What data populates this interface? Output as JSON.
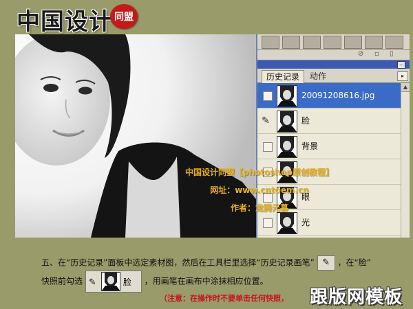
{
  "header": {
    "logo_text": "中国设计",
    "logo_seal": "同盟"
  },
  "history_panel": {
    "tabs": [
      {
        "label": "历史记录",
        "active": true
      },
      {
        "label": "动作",
        "active": false
      }
    ],
    "rows": [
      {
        "label": "20091208616.jpg",
        "selected": true,
        "source_brush": false
      },
      {
        "label": "脸",
        "selected": false,
        "source_brush": true
      },
      {
        "label": "背景",
        "selected": false,
        "source_brush": false
      },
      {
        "label": "",
        "selected": false,
        "source_brush": false
      },
      {
        "label": "眼",
        "selected": false,
        "source_brush": false
      },
      {
        "label": "光",
        "selected": false,
        "source_brush": false
      }
    ]
  },
  "watermark": {
    "line1": "中国设计同盟【photoshop原创教程】",
    "line2": "网址：www.cntoem.cn",
    "line3": "作者：龙腾元慕"
  },
  "instructions": {
    "line1_part1": "五、在“历史记录”面板中选定素材图，然后在工具栏里选择“历史记录画笔”",
    "line1_part2": "，在“脸”",
    "line2_part1": "快照前勾选",
    "line2_snapshot_label": "脸",
    "line2_part2": "，用画笔在画布中涂抹相应位置。",
    "note": "（注意：在操作时不要单击任何快照，"
  },
  "brand": {
    "logo_text": "跟版网模板"
  },
  "colors": {
    "background": "#999b6a",
    "selected_row": "#3a6bc8",
    "dock_bar": "#3d5ab0",
    "watermark": "#e8b21c",
    "note": "#c8141a"
  }
}
